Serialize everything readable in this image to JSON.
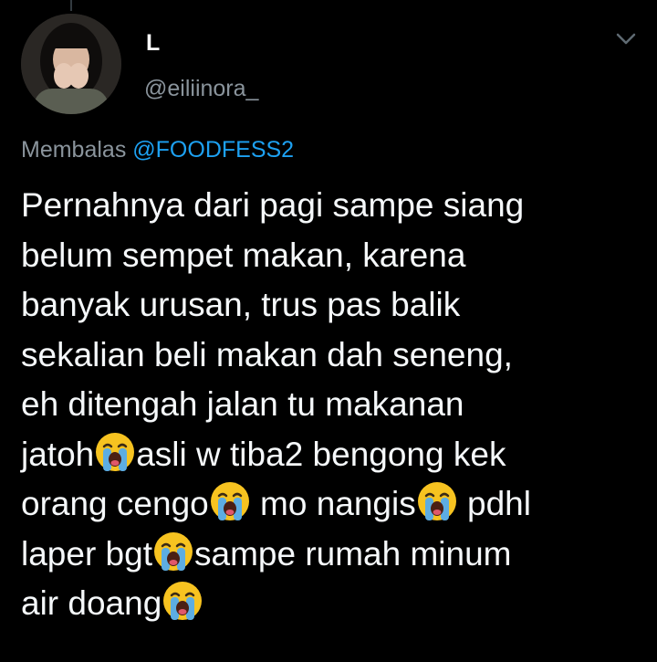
{
  "author": {
    "display_name": "L",
    "handle": "@eiliinora_"
  },
  "reply": {
    "prefix": "Membalas",
    "mention": "@FOODFESS2"
  },
  "tweet": {
    "lines": [
      "Pernahnya dari pagi sampe siang",
      "belum sempet makan, karena",
      "banyak urusan, trus pas balik",
      "sekalian beli makan dah seneng,",
      "eh ditengah jalan tu makanan",
      [
        "jatoh",
        "😭",
        "asli w tiba2 bengong kek"
      ],
      [
        "orang cengo",
        "😭",
        " mo nangis",
        "😭",
        " pdhl"
      ],
      [
        "laper bgt",
        "😭",
        "sampe rumah minum"
      ],
      [
        "air doang",
        "😭"
      ]
    ]
  },
  "icons": {
    "more": "chevron-down-icon",
    "emoji": "loudly-crying-face-emoji"
  },
  "colors": {
    "background": "#000000",
    "text": "#f5f8fa",
    "muted": "#8a949c",
    "accent": "#1da1f2",
    "emoji_face": "#f7c320",
    "emoji_tears": "#5dade2"
  }
}
